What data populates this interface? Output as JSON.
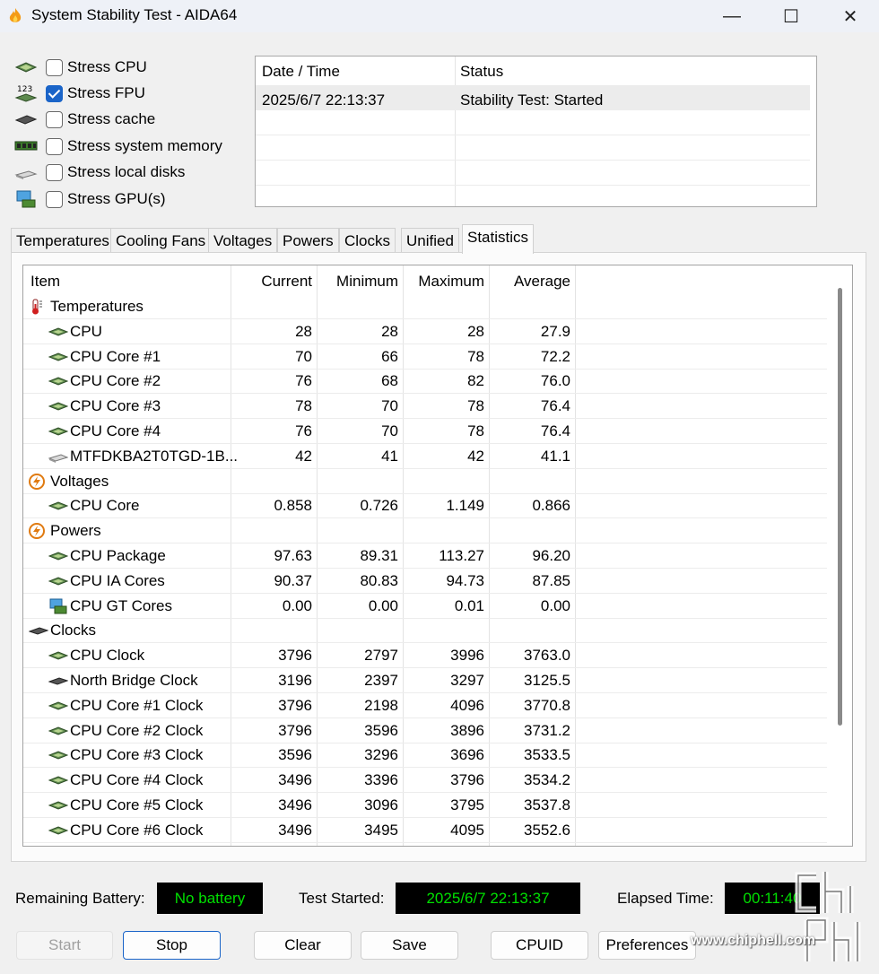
{
  "window": {
    "title": "System Stability Test - AIDA64",
    "minimize": "—",
    "maximize": "☐",
    "close": "✕"
  },
  "stress_options": [
    {
      "label": "Stress CPU",
      "checked": false,
      "icon": "cpu-chip-icon"
    },
    {
      "label": "Stress FPU",
      "checked": true,
      "icon": "fpu-numbers-icon"
    },
    {
      "label": "Stress cache",
      "checked": false,
      "icon": "cache-chip-icon"
    },
    {
      "label": "Stress system memory",
      "checked": false,
      "icon": "memory-module-icon"
    },
    {
      "label": "Stress local disks",
      "checked": false,
      "icon": "disk-drive-icon"
    },
    {
      "label": "Stress GPU(s)",
      "checked": false,
      "icon": "gpu-monitor-icon"
    }
  ],
  "log": {
    "headers": {
      "datetime": "Date / Time",
      "status": "Status"
    },
    "rows": [
      {
        "datetime": "2025/6/7 22:13:37",
        "status": "Stability Test: Started"
      }
    ]
  },
  "tabs": [
    {
      "label": "Temperatures"
    },
    {
      "label": "Cooling Fans"
    },
    {
      "label": "Voltages"
    },
    {
      "label": "Powers"
    },
    {
      "label": "Clocks"
    },
    {
      "label": "Unified"
    },
    {
      "label": "Statistics",
      "active": true
    }
  ],
  "stats": {
    "headers": {
      "item": "Item",
      "current": "Current",
      "minimum": "Minimum",
      "maximum": "Maximum",
      "average": "Average"
    },
    "rows": [
      {
        "group": true,
        "item": "Temperatures",
        "icon": "thermometer-icon"
      },
      {
        "item": "CPU",
        "current": "28",
        "minimum": "28",
        "maximum": "28",
        "average": "27.9",
        "icon": "cpu-chip-icon"
      },
      {
        "item": "CPU Core #1",
        "current": "70",
        "minimum": "66",
        "maximum": "78",
        "average": "72.2",
        "icon": "cpu-chip-icon"
      },
      {
        "item": "CPU Core #2",
        "current": "76",
        "minimum": "68",
        "maximum": "82",
        "average": "76.0",
        "icon": "cpu-chip-icon"
      },
      {
        "item": "CPU Core #3",
        "current": "78",
        "minimum": "70",
        "maximum": "78",
        "average": "76.4",
        "icon": "cpu-chip-icon"
      },
      {
        "item": "CPU Core #4",
        "current": "76",
        "minimum": "70",
        "maximum": "78",
        "average": "76.4",
        "icon": "cpu-chip-icon"
      },
      {
        "item": "MTFDKBA2T0TGD-1B...",
        "current": "42",
        "minimum": "41",
        "maximum": "42",
        "average": "41.1",
        "icon": "disk-drive-icon"
      },
      {
        "group": true,
        "item": "Voltages",
        "icon": "lightning-icon"
      },
      {
        "item": "CPU Core",
        "current": "0.858",
        "minimum": "0.726",
        "maximum": "1.149",
        "average": "0.866",
        "icon": "cpu-chip-icon"
      },
      {
        "group": true,
        "item": "Powers",
        "icon": "lightning-icon"
      },
      {
        "item": "CPU Package",
        "current": "97.63",
        "minimum": "89.31",
        "maximum": "113.27",
        "average": "96.20",
        "icon": "cpu-chip-icon"
      },
      {
        "item": "CPU IA Cores",
        "current": "90.37",
        "minimum": "80.83",
        "maximum": "94.73",
        "average": "87.85",
        "icon": "cpu-chip-icon"
      },
      {
        "item": "CPU GT Cores",
        "current": "0.00",
        "minimum": "0.00",
        "maximum": "0.01",
        "average": "0.00",
        "icon": "gpu-monitor-icon"
      },
      {
        "group": true,
        "item": "Clocks",
        "icon": "clock-chip-icon"
      },
      {
        "item": "CPU Clock",
        "current": "3796",
        "minimum": "2797",
        "maximum": "3996",
        "average": "3763.0",
        "icon": "cpu-chip-icon"
      },
      {
        "item": "North Bridge Clock",
        "current": "3196",
        "minimum": "2397",
        "maximum": "3297",
        "average": "3125.5",
        "icon": "chipset-icon"
      },
      {
        "item": "CPU Core #1 Clock",
        "current": "3796",
        "minimum": "2198",
        "maximum": "4096",
        "average": "3770.8",
        "icon": "cpu-chip-icon"
      },
      {
        "item": "CPU Core #2 Clock",
        "current": "3796",
        "minimum": "3596",
        "maximum": "3896",
        "average": "3731.2",
        "icon": "cpu-chip-icon"
      },
      {
        "item": "CPU Core #3 Clock",
        "current": "3596",
        "minimum": "3296",
        "maximum": "3696",
        "average": "3533.5",
        "icon": "cpu-chip-icon"
      },
      {
        "item": "CPU Core #4 Clock",
        "current": "3496",
        "minimum": "3396",
        "maximum": "3796",
        "average": "3534.2",
        "icon": "cpu-chip-icon"
      },
      {
        "item": "CPU Core #5 Clock",
        "current": "3496",
        "minimum": "3096",
        "maximum": "3795",
        "average": "3537.8",
        "icon": "cpu-chip-icon"
      },
      {
        "item": "CPU Core #6 Clock",
        "current": "3496",
        "minimum": "3495",
        "maximum": "4095",
        "average": "3552.6",
        "icon": "cpu-chip-icon"
      }
    ]
  },
  "status": {
    "battery_label": "Remaining Battery:",
    "battery_value": "No battery",
    "started_label": "Test Started:",
    "started_value": "2025/6/7 22:13:37",
    "elapsed_label": "Elapsed Time:",
    "elapsed_value": "00:11:40"
  },
  "buttons": {
    "start": "Start",
    "stop": "Stop",
    "clear": "Clear",
    "save": "Save",
    "cpuid": "CPUID",
    "preferences": "Preferences"
  },
  "watermark": "www.chiphell.com",
  "colors": {
    "lcd_bg": "#000000",
    "lcd_text": "#00e000",
    "accent": "#1a64c8"
  }
}
